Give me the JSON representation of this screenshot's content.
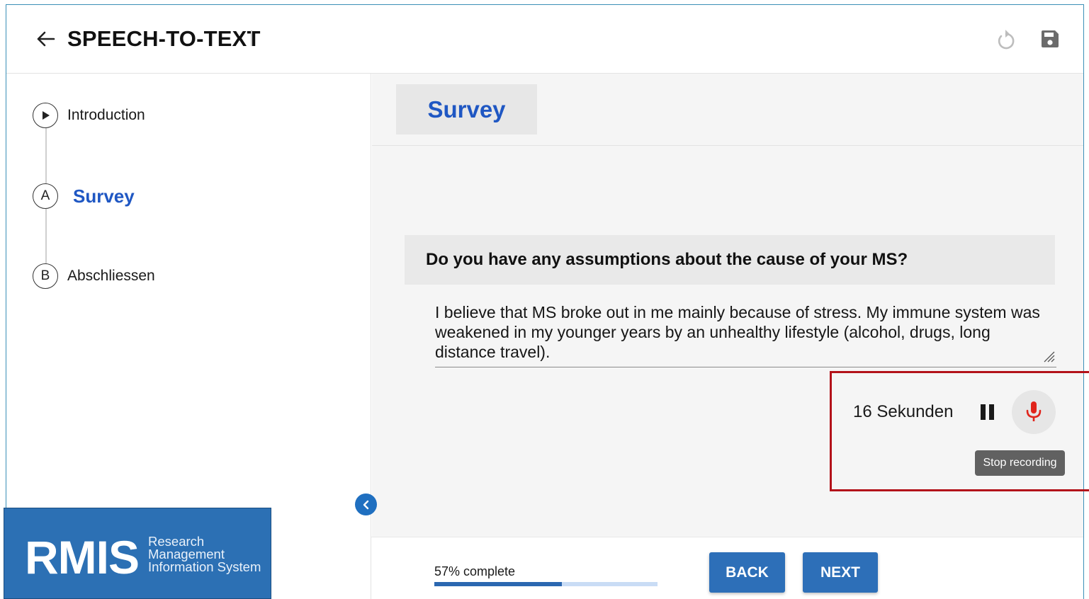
{
  "header": {
    "title": "SPEECH-TO-TEXT",
    "back_icon": "arrow-left-icon",
    "undo_icon": "undo-icon",
    "save_icon": "floppy-disk-icon"
  },
  "sidebar": {
    "steps": [
      {
        "marker": "▶",
        "label": "Introduction",
        "state": "done"
      },
      {
        "marker": "A",
        "label": "Survey",
        "state": "active"
      },
      {
        "marker": "B",
        "label": "Abschliessen",
        "state": "pending"
      }
    ],
    "collapse_icon": "chevron-left-icon"
  },
  "main": {
    "section_title": "Survey",
    "question": "Do you have any assumptions about the cause of your MS?",
    "answer": "I believe that MS broke out in me mainly because of stress. My immune system was weakened in my younger years by an unhealthy lifestyle (alcohol, drugs, long distance travel).",
    "recorder": {
      "elapsed": "16 Sekunden",
      "tooltip": "Stop recording",
      "pause_icon": "pause-icon",
      "mic_icon": "microphone-icon"
    }
  },
  "footer": {
    "progress_label": "57% complete",
    "progress_fraction": 0.57,
    "back_label": "BACK",
    "next_label": "NEXT"
  },
  "logo": {
    "main": "RMIS",
    "line1": "Research",
    "line2": "Management",
    "line3": "Information System"
  },
  "colors": {
    "accent": "#1f57c3",
    "button": "#2d6fb8",
    "mic": "#e0241b",
    "highlight": "#b3121a"
  }
}
